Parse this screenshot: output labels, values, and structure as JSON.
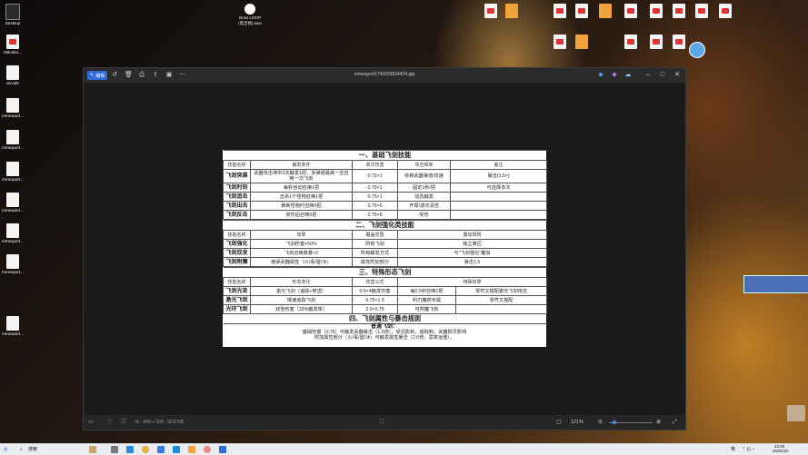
{
  "desktop": {
    "icons_left": [
      {
        "label": "Desktop"
      },
      {
        "label": "517档案资料"
      },
      {
        "label": "Mitusbo..."
      },
      {
        "label": "arcade"
      },
      {
        "label": "mmexport..."
      },
      {
        "label": "mmexport..."
      },
      {
        "label": "mmexport..."
      },
      {
        "label": "mmexport..."
      },
      {
        "label": "mmexport..."
      },
      {
        "label": "mmexport..."
      },
      {
        "label": "mmexport..."
      }
    ],
    "icon_top": {
      "label_line1": "Boss LOOP",
      "label_line2": "(电吉他).wav"
    },
    "icons_right_row1": [
      "",
      "",
      "",
      "",
      "",
      "",
      ""
    ],
    "icons_right_row2": [
      "",
      "",
      "",
      "",
      ""
    ]
  },
  "viewer": {
    "edit_label": "编辑",
    "file_name": "mmexport1740559624424.jpg",
    "bottom": {
      "dims": "1k · 849 x 339 · 93.6 KB",
      "zoom": "121%"
    }
  },
  "doc": {
    "section1": "一、基础飞剑技能",
    "s1_headers": [
      "技能名称",
      "触发条件",
      "单次伤害",
      "攻击频率",
      "备注"
    ],
    "s1_rows": [
      [
        "飞剑突袭",
        "武器攻击命中2次触发1把，多弹道最高一击召唤一次飞剑",
        "0.75×1",
        "依赖武器弹道/攻速",
        "暴击(1.5×)"
      ],
      [
        "飞剑时刻",
        "每秒自动召唤1把",
        "0.75×1",
        "固定1秒/把",
        "可选择多次"
      ],
      [
        "飞剑追击",
        "击杀1个怪物召唤1把",
        "0.75×1",
        "动态触发",
        ""
      ],
      [
        "飞剑出击",
        "刷新怪物时召唤5把",
        "0.75×5",
        "开局/波次清怪",
        ""
      ],
      [
        "飞剑反击",
        "受伤后召唤5把",
        "0.75×5",
        "受伤",
        ""
      ]
    ],
    "section2": "二、飞剑强化类技能",
    "s2_headers": [
      "技能名称",
      "效果",
      "覆盖范围",
      "叠加规则"
    ],
    "s2_rows": [
      [
        "飞剑强化",
        "飞剑伤害+50%",
        "所有飞剑",
        "独立乘区"
      ],
      [
        "飞剑双发",
        "飞剑召唤数量×2",
        "所有触发方式",
        "与\"飞剑强化\"叠加"
      ],
      [
        "飞剑附魔",
        "继承武器属性（火/毒/雷/冰）",
        "属性附加部分",
        "暴击1.5"
      ]
    ],
    "section3": "三、特殊形态飞剑",
    "s3_headers": [
      "技能名称",
      "形态变化",
      "伤害公式",
      "特殊效果"
    ],
    "s3_rows": [
      [
        "飞剑光束",
        "激光飞剑（追踪+穿透）",
        "0.5×4触发伤害",
        "每2.5秒召唤1把",
        "零符文搭配激光飞剑攻击"
      ],
      [
        "激光飞剑",
        "慢速追踪飞剑",
        "0.75×1.3",
        "利刃魔药专属",
        "零符文搭配"
      ],
      [
        "光环飞剑",
        "双倍伤害（33%触发率）",
        "2.0×0.75",
        "可附魔飞剑",
        ""
      ]
    ],
    "section4": "四、飞剑属性与暴击规则",
    "section4_sub": "普通飞剑：",
    "notes": [
      "基础伤害（0.75）可触发武器暴击（1.5倍），受迅影刺、追踪刺、武器附灵影响",
      "附加属性部分（火/毒/雷/冰）可触发属性暴击（2.0倍，需率运值）。"
    ]
  },
  "taskbar": {
    "search": "搜索",
    "lang": "英",
    "time": "23:58",
    "date": "2025/3/2"
  }
}
